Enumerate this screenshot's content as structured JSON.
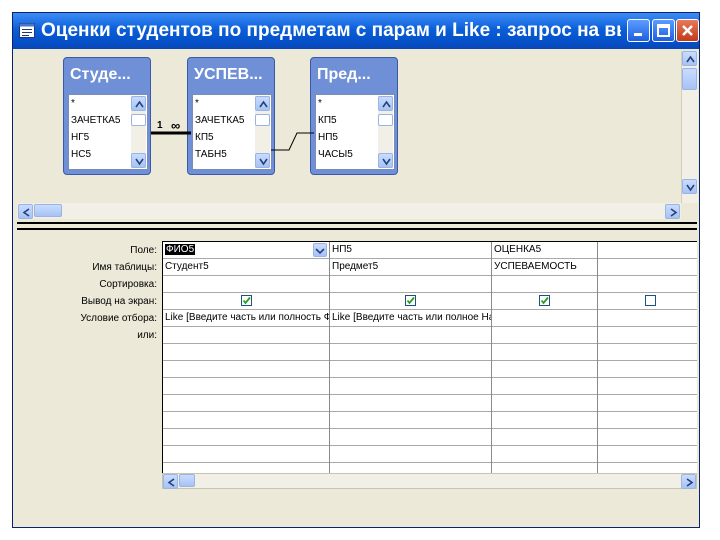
{
  "window": {
    "title": "Оценки студентов по предметам с парам и Like : запрос на выбо..."
  },
  "tables": [
    {
      "title": "Студе...",
      "fields": [
        "*",
        "ЗАЧЕТКА5",
        "НГ5",
        "НС5"
      ]
    },
    {
      "title": "УСПЕВ...",
      "fields": [
        "*",
        "ЗАЧЕТКА5",
        "КП5",
        "ТАБН5"
      ]
    },
    {
      "title": "Пред...",
      "fields": [
        "*",
        "КП5",
        "НП5",
        "ЧАСЫ5"
      ]
    }
  ],
  "relationship": {
    "one": "1",
    "many": "∞"
  },
  "grid": {
    "row_labels": {
      "field": "Поле:",
      "table": "Имя таблицы:",
      "sort": "Сортировка:",
      "show": "Вывод на экран:",
      "criteria": "Условие отбора:",
      "or": "или:"
    },
    "columns": [
      {
        "field": "ФИО5",
        "table": "Студент5",
        "sort": "",
        "show": true,
        "criteria": "Like [Введите часть или полность ФИ",
        "or": ""
      },
      {
        "field": "НП5",
        "table": "Предмет5",
        "sort": "",
        "show": true,
        "criteria": "Like [Введите часть или полное Наим",
        "or": ""
      },
      {
        "field": "ОЦЕНКА5",
        "table": "УСПЕВАЕМОСТЬ",
        "sort": "",
        "show": true,
        "criteria": "",
        "or": ""
      },
      {
        "field": "",
        "table": "",
        "sort": "",
        "show": false,
        "criteria": "",
        "or": ""
      }
    ]
  },
  "icons": [
    "query-icon",
    "minimize-icon",
    "maximize-icon",
    "close-icon",
    "scroll-up-icon",
    "scroll-down-icon",
    "scroll-left-icon",
    "scroll-right-icon",
    "dropdown-arrow-icon",
    "checkmark-icon"
  ],
  "colors": {
    "titlebar": "#0a5fd8",
    "table_header": "#6f8fd6",
    "window_bg": "#ece9d8"
  }
}
